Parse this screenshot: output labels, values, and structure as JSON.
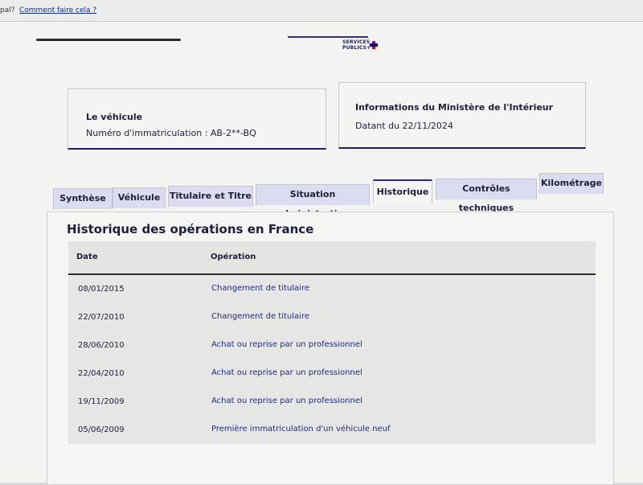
{
  "topbar": {
    "cut_text": "pal?",
    "link": "Comment faire cela ?"
  },
  "logo": {
    "line1": "SERVICES",
    "line2": "PUBLICS+"
  },
  "vehicle_card": {
    "title": "Le véhicule",
    "registration": "Numéro d'immatriculation : AB-2**-BQ"
  },
  "ministry_card": {
    "title": "Informations du Ministère de l'Intérieur",
    "date": "Datant du 22/11/2024"
  },
  "tabs": [
    {
      "label": "Synthèse"
    },
    {
      "label": "Véhicule"
    },
    {
      "label": "Titulaire et Titre"
    },
    {
      "label": "Situation administrative"
    },
    {
      "label": "Historique",
      "active": true
    },
    {
      "label": "Contrôles techniques"
    },
    {
      "label": "Kilométrage"
    }
  ],
  "history": {
    "title": "Historique des opérations en France",
    "col_date": "Date",
    "col_operation": "Opération",
    "rows": [
      {
        "date": "08/01/2015",
        "operation": "Changement de titulaire"
      },
      {
        "date": "22/07/2010",
        "operation": "Changement de titulaire"
      },
      {
        "date": "28/06/2010",
        "operation": "Achat ou reprise par un professionnel"
      },
      {
        "date": "22/04/2010",
        "operation": "Achat ou reprise par un professionnel"
      },
      {
        "date": "19/11/2009",
        "operation": "Achat ou reprise par un professionnel"
      },
      {
        "date": "05/06/2009",
        "operation": "Première immatriculation d'un véhicule neuf"
      }
    ]
  }
}
